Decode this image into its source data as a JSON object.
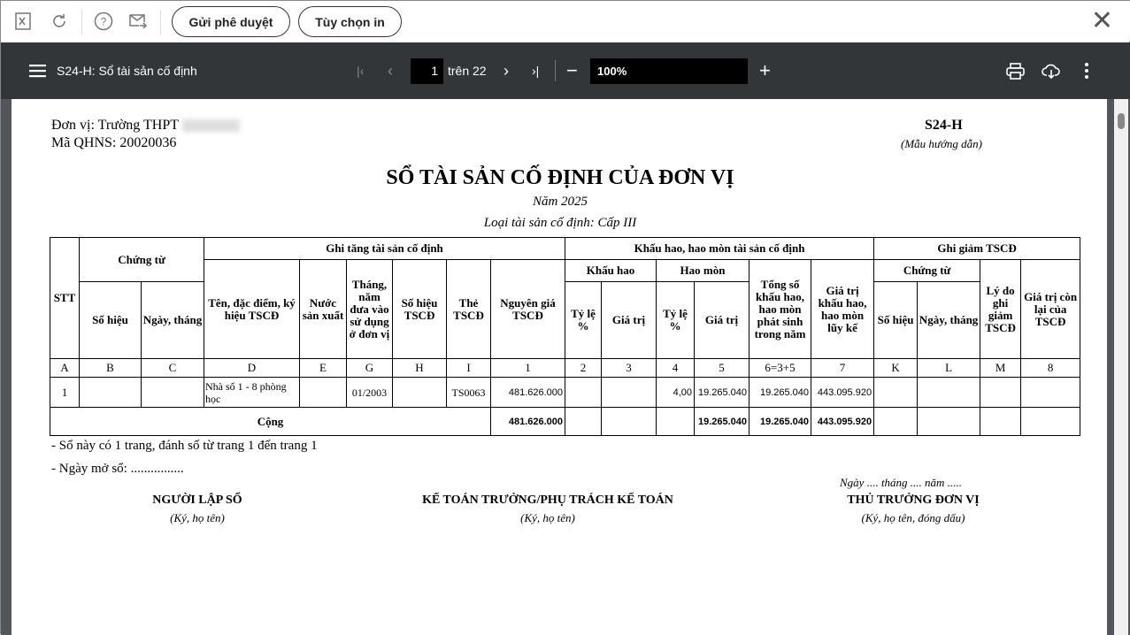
{
  "toolbar": {
    "send_approval": "Gửi phê duyệt",
    "print_options": "Tùy chọn in"
  },
  "viewer": {
    "title": "S24-H: Sổ tài sản cố định",
    "page": "1",
    "of_pages": "trên 22",
    "zoom": "100%"
  },
  "doc": {
    "unit": "Đơn vị: Trường THPT",
    "qhns": "Mã QHNS: 20020036",
    "form_code": "S24-H",
    "form_note": "(Mẫu hướng dẫn)",
    "title": "SỔ TÀI SẢN CỐ ĐỊNH CỦA ĐƠN VỊ",
    "year": "Năm 2025",
    "type": "Loại tài sản cố định: Cấp III",
    "headers": {
      "stt": "STT",
      "chung_tu": "Chứng từ",
      "ghi_tang": "Ghi tăng tài sản cố định",
      "khau_hao_group": "Khấu hao, hao mòn tài sản cố định",
      "ghi_giam": "Ghi giảm TSCĐ",
      "so_hieu": "Số hiệu",
      "ngay_thang": "Ngày, tháng",
      "ten": "Tên, đặc điểm, ký hiệu TSCĐ",
      "nuoc": "Nước sản xuất",
      "thang_nam": "Tháng, năm đưa vào sử dụng ở đơn vị",
      "so_hieu_tscd": "Số hiệu TSCĐ",
      "the": "Thẻ TSCĐ",
      "nguyen_gia": "Nguyên giá TSCĐ",
      "khau_hao": "Khấu hao",
      "hao_mon": "Hao mòn",
      "ty_le": "Tỷ lệ %",
      "gia_tri": "Giá trị",
      "tong_so": "Tổng số khấu hao, hao mòn phát sinh trong năm",
      "luy_ke": "Giá trị khấu hao, hao mòn lũy kế",
      "ly_do": "Lý do ghi giảm TSCĐ",
      "con_lai": "Giá trị còn lại của TSCĐ"
    },
    "codes": [
      "A",
      "B",
      "C",
      "D",
      "E",
      "G",
      "H",
      "I",
      "1",
      "2",
      "3",
      "4",
      "5",
      "6=3+5",
      "7",
      "K",
      "L",
      "M",
      "8"
    ],
    "rows": [
      {
        "stt": "1",
        "so_hieu": "",
        "ngay": "",
        "ten": "Nhà số 1 - 8 phòng học",
        "nuoc": "",
        "thang_nam": "01/2003",
        "so_hieu_tscd": "",
        "the": "TS0063",
        "nguyen_gia": "481.626.000",
        "kh_ty_le": "",
        "kh_gia_tri": "",
        "hm_ty_le": "4,00",
        "hm_gia_tri": "19.265.040",
        "tong": "19.265.040",
        "luy_ke": "443.095.920"
      }
    ],
    "total": {
      "label": "Cộng",
      "nguyen_gia": "481.626.000",
      "hm_gia_tri": "19.265.040",
      "tong": "19.265.040",
      "luy_ke": "443.095.920"
    },
    "note1": "- Sổ này có 1 trang, đánh số từ trang 1 đến trang 1",
    "note2": "- Ngày mở sổ: ................",
    "date_line": "Ngày .... tháng .... năm .....",
    "sig1": {
      "title": "NGƯỜI LẬP SỔ",
      "note": "(Ký, họ tên)"
    },
    "sig2": {
      "title": "KẾ TOÁN TRƯỞNG/PHỤ TRÁCH KẾ TOÁN",
      "note": "(Ký, họ tên)"
    },
    "sig3": {
      "title": "THỦ TRƯỞNG ĐƠN VỊ",
      "note": "(Ký, họ tên, đóng dấu)"
    }
  }
}
